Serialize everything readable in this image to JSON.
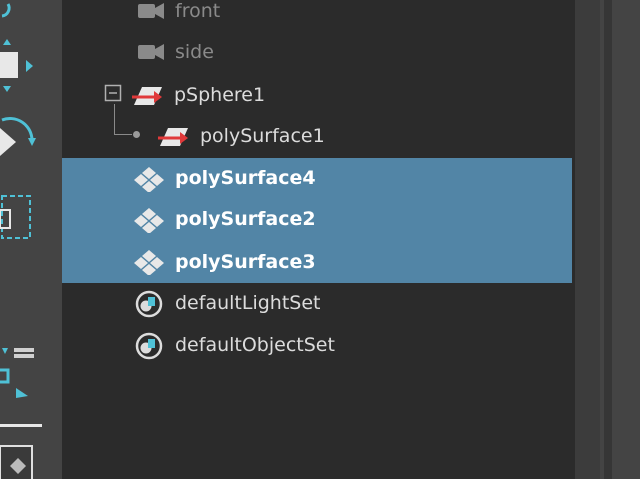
{
  "outliner": {
    "rows": [
      {
        "label": "front",
        "icon": "camera-icon"
      },
      {
        "label": "side",
        "icon": "camera-icon"
      },
      {
        "label": "pSphere1",
        "icon": "transform-icon",
        "expander": "collapse-minus-icon"
      },
      {
        "label": "polySurface1",
        "icon": "transform-icon"
      },
      {
        "label": "polySurface4",
        "icon": "mesh-icon",
        "selected": true
      },
      {
        "label": "polySurface2",
        "icon": "mesh-icon",
        "selected": true
      },
      {
        "label": "polySurface3",
        "icon": "mesh-icon",
        "selected": true
      },
      {
        "label": "defaultLightSet",
        "icon": "set-icon"
      },
      {
        "label": "defaultObjectSet",
        "icon": "set-icon"
      }
    ]
  },
  "colors": {
    "selection": "#5285a6",
    "panel": "#2b2b2b",
    "accent_cyan": "#4fc1d6",
    "transform_red": "#e0393a"
  }
}
